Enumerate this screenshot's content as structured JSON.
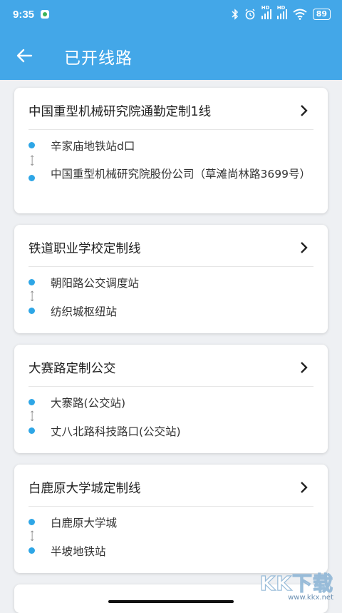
{
  "status_bar": {
    "time": "9:35",
    "battery": "89",
    "hd": "HD"
  },
  "app_bar": {
    "title": "已开线路"
  },
  "routes": [
    {
      "name": "中国重型机械研究院通勤定制1线",
      "from": "辛家庙地铁站d口",
      "to": "中国重型机械研究院股份公司（草滩尚林路3699号）"
    },
    {
      "name": "铁道职业学校定制线",
      "from": "朝阳路公交调度站",
      "to": "纺织城枢纽站"
    },
    {
      "name": "大赛路定制公交",
      "from": "大寨路(公交站)",
      "to": "丈八北路科技路口(公交站)"
    },
    {
      "name": "白鹿原大学城定制线",
      "from": "白鹿原大学城",
      "to": "半坡地铁站"
    }
  ],
  "watermark": {
    "text": "KK下载",
    "url": "www.kkx.net"
  },
  "colors": {
    "primary": "#43a7e8",
    "dot": "#2ea6e6"
  }
}
